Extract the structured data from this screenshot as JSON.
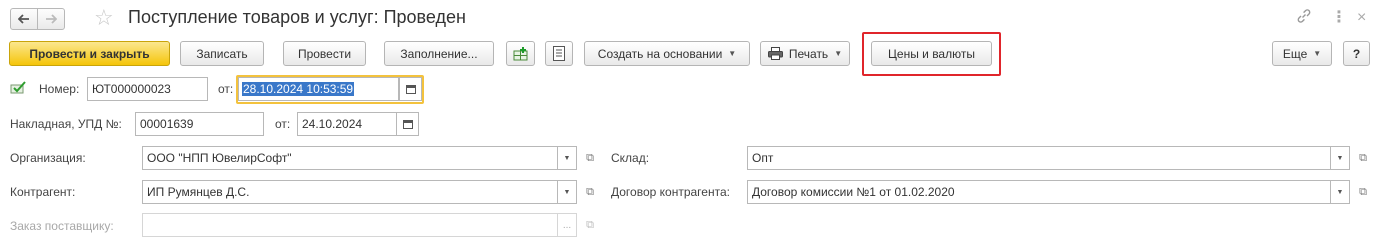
{
  "window": {
    "title": "Поступление товаров и услуг: Проведен",
    "icons": {
      "back": "arrow-left-icon",
      "forward": "arrow-right-icon",
      "favorite": "star-icon",
      "link": "link-icon",
      "more": "more-vert-icon",
      "close": "close-icon"
    }
  },
  "toolbar": {
    "post_and_close": "Провести и закрыть",
    "save": "Записать",
    "post": "Провести",
    "fill": "Заполнение...",
    "create_based_on": "Создать на основании",
    "print": "Печать",
    "prices_and_currencies": "Цены и валюты",
    "more": "Еще",
    "help": "?",
    "highlight_color": "#e0252b"
  },
  "form": {
    "number_label": "Номер:",
    "number_value": "ЮТ000000023",
    "from_label": "от:",
    "date_value": "28.10.2024 10:53:59",
    "invoice_label": "Накладная, УПД №:",
    "invoice_value": "00001639",
    "invoice_from_label": "от:",
    "invoice_date": "24.10.2024",
    "organization_label": "Организация:",
    "organization_value": "ООО \"НПП ЮвелирСофт\"",
    "warehouse_label": "Склад:",
    "warehouse_value": "Опт",
    "counterparty_label": "Контрагент:",
    "counterparty_value": "ИП Румянцев Д.С.",
    "contract_label": "Договор  контрагента:",
    "contract_value": "Договор комиссии №1 от 01.02.2020",
    "supplier_order_label": "Заказ поставщику:",
    "supplier_order_value": "",
    "ellipsis": "..."
  }
}
